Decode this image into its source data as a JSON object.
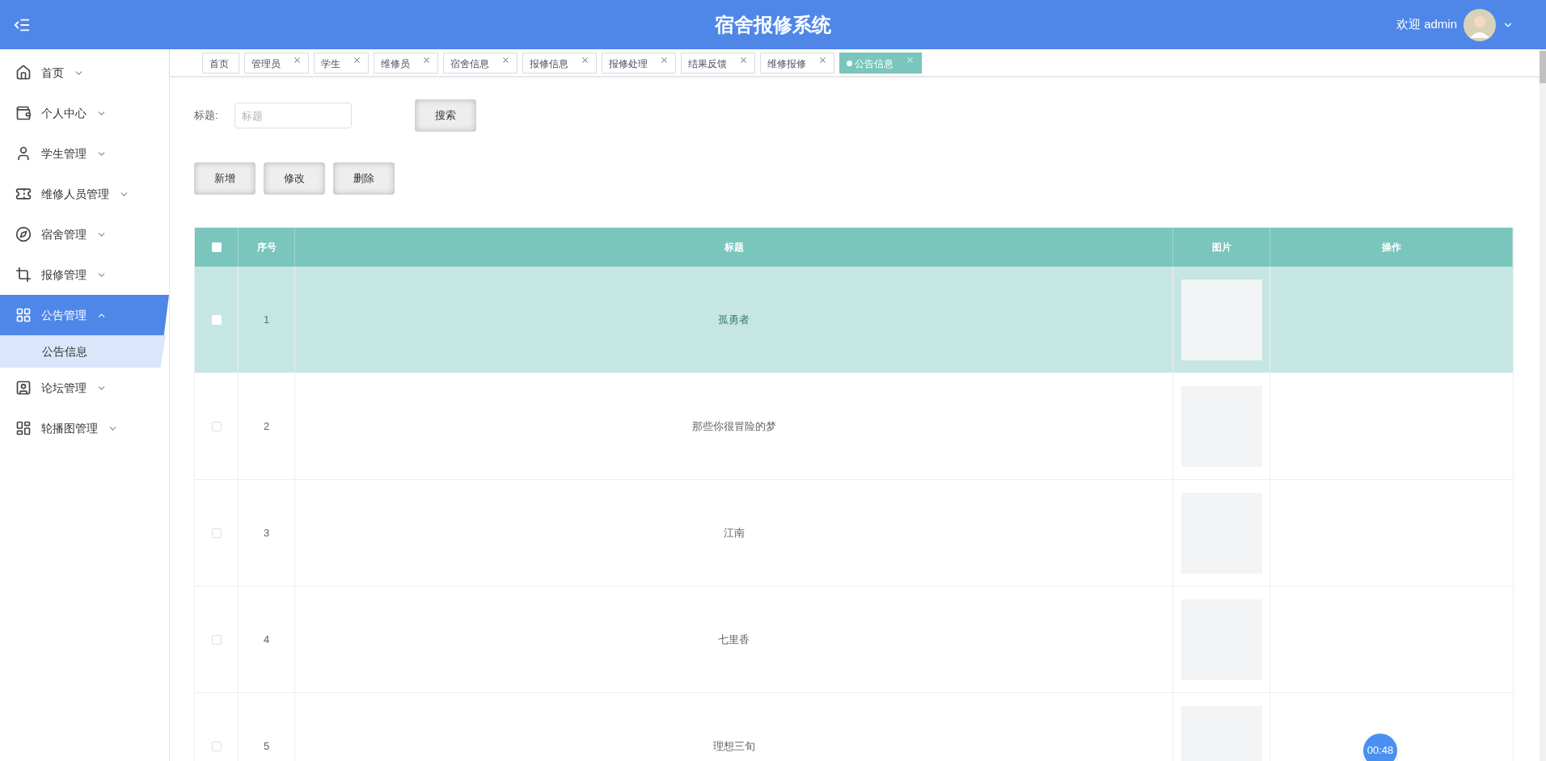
{
  "header": {
    "title": "宿舍报修系统",
    "welcome": "欢迎 admin"
  },
  "sidebar": {
    "items": [
      {
        "label": "首页",
        "expanded": false,
        "selected": false
      },
      {
        "label": "个人中心",
        "expanded": false,
        "selected": false
      },
      {
        "label": "学生管理",
        "expanded": false,
        "selected": false
      },
      {
        "label": "维修人员管理",
        "expanded": false,
        "selected": false
      },
      {
        "label": "宿舍管理",
        "expanded": false,
        "selected": false
      },
      {
        "label": "报修管理",
        "expanded": false,
        "selected": false
      },
      {
        "label": "公告管理",
        "expanded": true,
        "selected": true,
        "children": [
          {
            "label": "公告信息",
            "selected": true
          }
        ]
      },
      {
        "label": "论坛管理",
        "expanded": false,
        "selected": false
      },
      {
        "label": "轮播图管理",
        "expanded": false,
        "selected": false
      }
    ]
  },
  "tabs": [
    {
      "label": "首页",
      "closable": false,
      "selected": false
    },
    {
      "label": "管理员",
      "closable": true,
      "selected": false
    },
    {
      "label": "学生",
      "closable": true,
      "selected": false
    },
    {
      "label": "维修员",
      "closable": true,
      "selected": false
    },
    {
      "label": "宿舍信息",
      "closable": true,
      "selected": false
    },
    {
      "label": "报修信息",
      "closable": true,
      "selected": false
    },
    {
      "label": "报修处理",
      "closable": true,
      "selected": false
    },
    {
      "label": "结果反馈",
      "closable": true,
      "selected": false
    },
    {
      "label": "维修报修",
      "closable": true,
      "selected": false
    },
    {
      "label": "公告信息",
      "closable": true,
      "selected": true
    }
  ],
  "search": {
    "label": "标题:",
    "placeholder": "标题",
    "button": "搜索"
  },
  "actions": [
    "新增",
    "修改",
    "删除"
  ],
  "table": {
    "select_all": {
      "checked": false
    },
    "columns": [
      "序号",
      "标题",
      "图片",
      "操作"
    ],
    "rows": [
      {
        "index": "1",
        "title": "孤勇者",
        "selected": true
      },
      {
        "index": "2",
        "title": "那些你很冒险的梦",
        "selected": false
      },
      {
        "index": "3",
        "title": "江南",
        "selected": false
      },
      {
        "index": "4",
        "title": "七里香",
        "selected": false
      },
      {
        "index": "5",
        "title": "理想三旬",
        "selected": false
      }
    ]
  },
  "timer": "00:48"
}
